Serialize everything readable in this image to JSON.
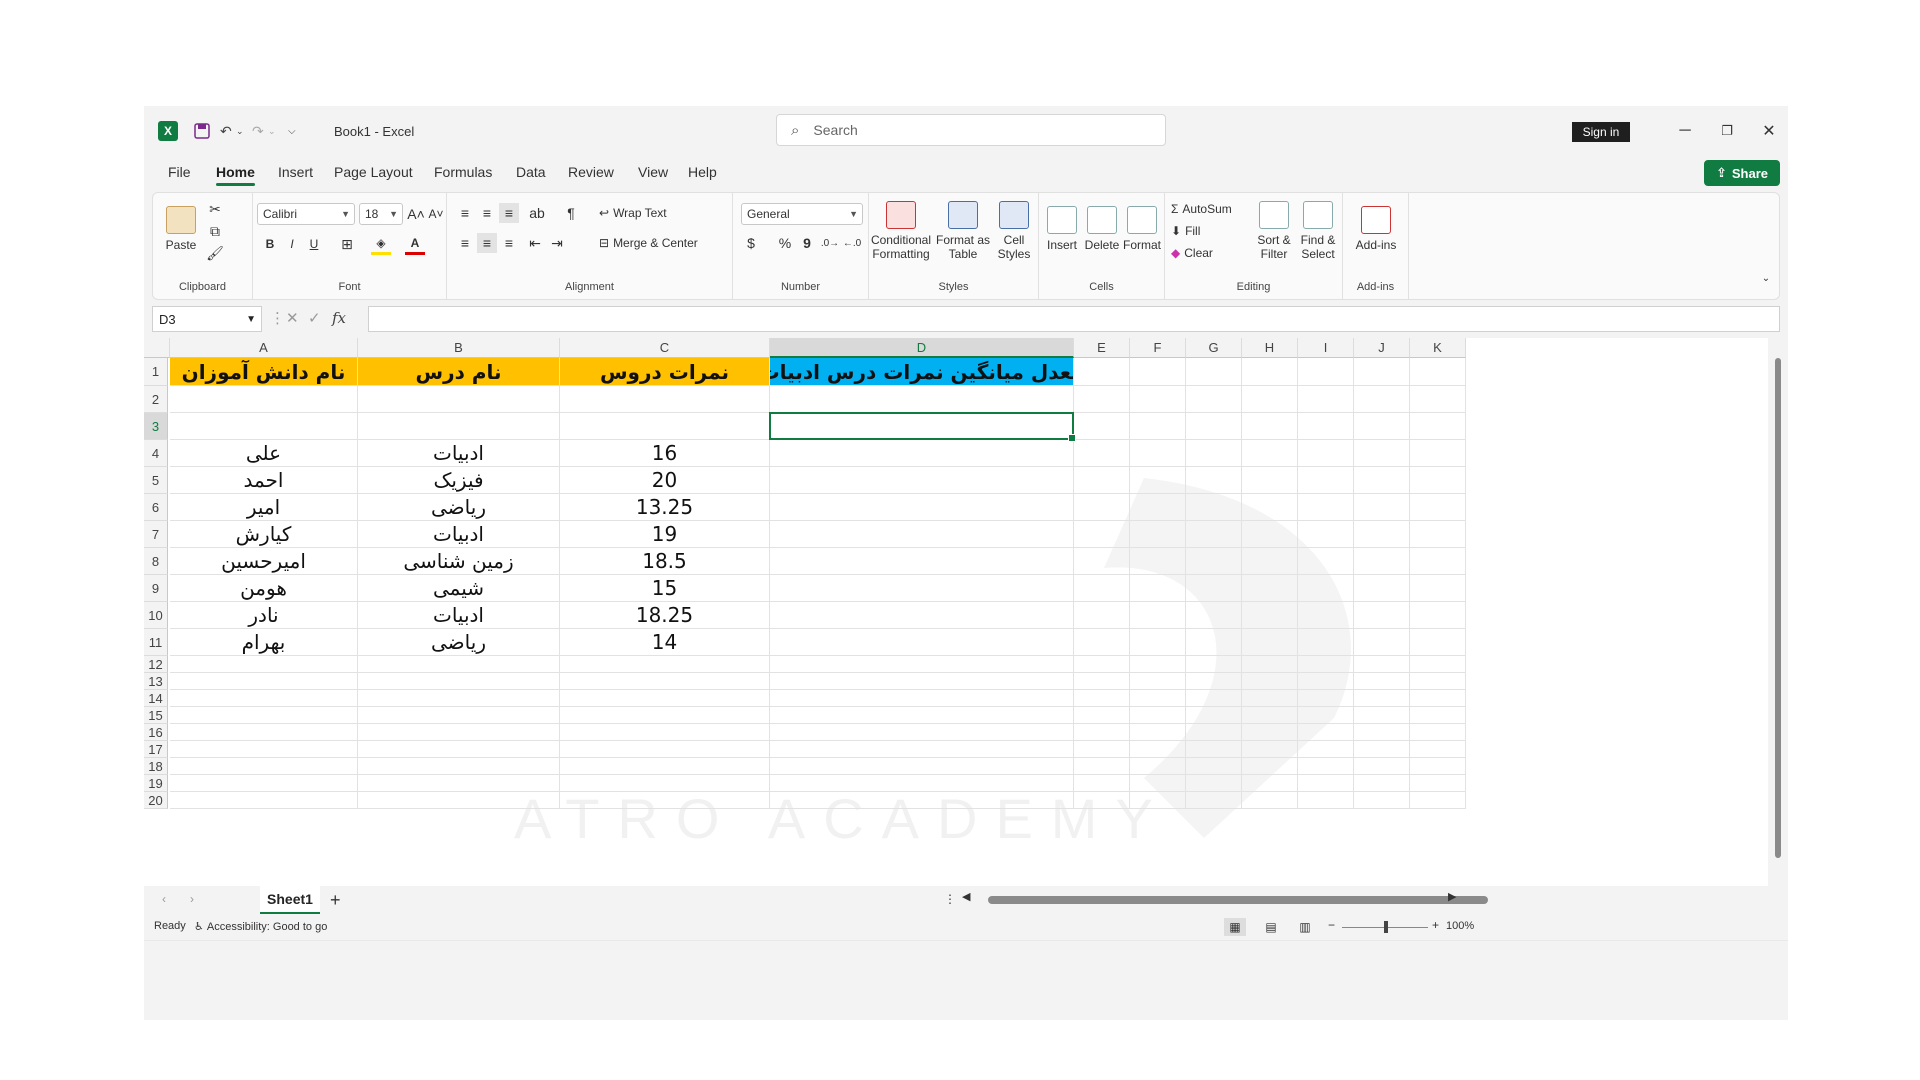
{
  "titlebar": {
    "app_icon": "X",
    "doc_title": "Book1  -  Excel",
    "search_placeholder": "Search",
    "signin_label": "Sign in",
    "share_label": "Share"
  },
  "menu": [
    "File",
    "Home",
    "Insert",
    "Page Layout",
    "Formulas",
    "Data",
    "Review",
    "View",
    "Help"
  ],
  "ribbon": {
    "clipboard": {
      "paste": "Paste",
      "label": "Clipboard"
    },
    "font": {
      "family": "Calibri",
      "size": "18",
      "label": "Font",
      "bold": "B",
      "italic": "I",
      "underline": "U"
    },
    "alignment": {
      "wrap": "Wrap Text",
      "merge": "Merge & Center",
      "label": "Alignment"
    },
    "number": {
      "format": "General",
      "label": "Number",
      "currency": "$",
      "percent": "%",
      "comma": "9"
    },
    "styles": {
      "cond": "Conditional Formatting",
      "table": "Format as Table",
      "cell": "Cell Styles",
      "label": "Styles"
    },
    "cells": {
      "insert": "Insert",
      "delete": "Delete",
      "format": "Format",
      "label": "Cells"
    },
    "editing": {
      "autosum": "AutoSum",
      "fill": "Fill",
      "clear": "Clear",
      "sort": "Sort & Filter",
      "find": "Find & Select",
      "label": "Editing"
    },
    "addins": {
      "addins": "Add-ins",
      "label": "Add-ins"
    }
  },
  "formula_bar": {
    "name_box": "D3",
    "fx": "fx",
    "formula": ""
  },
  "columns": [
    "A",
    "B",
    "C",
    "D",
    "E",
    "F",
    "G",
    "H",
    "I",
    "J",
    "K"
  ],
  "rows": [
    "1",
    "2",
    "3",
    "4",
    "5",
    "6",
    "7",
    "8",
    "9",
    "10",
    "11",
    "12",
    "13",
    "14",
    "15",
    "16",
    "17",
    "18",
    "19",
    "20"
  ],
  "table": {
    "headers": [
      "نام دانش آموزان",
      "نام درس",
      "نمرات دروس",
      "معدل میانگین نمرات درس ادبیات"
    ],
    "data": [
      [
        "علی",
        "ادبیات",
        "16"
      ],
      [
        "احمد",
        "فیزیک",
        "20"
      ],
      [
        "امیر",
        "ریاضی",
        "13.25"
      ],
      [
        "کیارش",
        "ادبیات",
        "19"
      ],
      [
        "امیرحسین",
        "زمین شناسی",
        "18.5"
      ],
      [
        "هومن",
        "شیمی",
        "15"
      ],
      [
        "نادر",
        "ادبیات",
        "18.25"
      ],
      [
        "بهرام",
        "ریاضی",
        "14"
      ]
    ]
  },
  "watermark": {
    "text": "ATRO ACADEMY"
  },
  "sheets": {
    "active": "Sheet1",
    "add": "+"
  },
  "status": {
    "ready": "Ready",
    "accessibility": "Accessibility: Good to go",
    "zoom": "100%"
  },
  "colors": {
    "excel_green": "#107c41",
    "header_yellow": "#ffc000",
    "header_blue": "#00b0f0"
  }
}
